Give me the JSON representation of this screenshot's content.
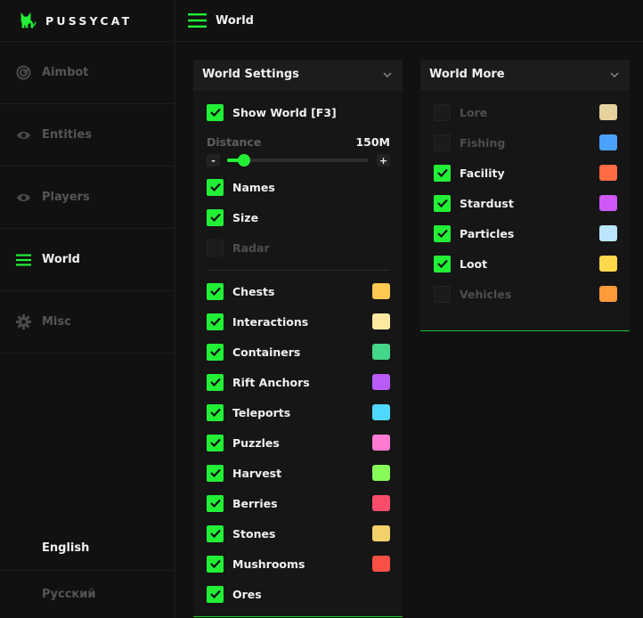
{
  "app": {
    "brand": "PUSSYCAT"
  },
  "header": {
    "title": "World"
  },
  "sidebar": {
    "items": [
      {
        "label": "Aimbot",
        "icon": "crosshair-icon"
      },
      {
        "label": "Entities",
        "icon": "eye-icon"
      },
      {
        "label": "Players",
        "icon": "eye-icon"
      },
      {
        "label": "World",
        "icon": "menu-icon",
        "active": true
      },
      {
        "label": "Misc",
        "icon": "gear-icon"
      }
    ],
    "languages": [
      "English",
      "Русский"
    ],
    "selected_language": "English"
  },
  "world_settings": {
    "title": "World Settings",
    "show_world": {
      "label": "Show World [F3]",
      "checked": true
    },
    "distance": {
      "label": "Distance",
      "value": "150M",
      "fraction": 0.12,
      "minus": "-",
      "plus": "+"
    },
    "options": [
      {
        "label": "Names",
        "checked": true
      },
      {
        "label": "Size",
        "checked": true
      },
      {
        "label": "Radar",
        "checked": false
      }
    ],
    "items": [
      {
        "label": "Chests",
        "checked": true,
        "color": "#ffc850"
      },
      {
        "label": "Interactions",
        "checked": true,
        "color": "#ffe9a0"
      },
      {
        "label": "Containers",
        "checked": true,
        "color": "#44d68a"
      },
      {
        "label": "Rift Anchors",
        "checked": true,
        "color": "#b85cf7"
      },
      {
        "label": "Teleports",
        "checked": true,
        "color": "#4fd8ff"
      },
      {
        "label": "Puzzles",
        "checked": true,
        "color": "#ff7ad2"
      },
      {
        "label": "Harvest",
        "checked": true,
        "color": "#86fb5a"
      },
      {
        "label": "Berries",
        "checked": true,
        "color": "#fc4c6c"
      },
      {
        "label": "Stones",
        "checked": true,
        "color": "#f4d06a"
      },
      {
        "label": "Mushrooms",
        "checked": true,
        "color": "#fc5046"
      },
      {
        "label": "Ores",
        "checked": true,
        "color": null
      }
    ]
  },
  "world_more": {
    "title": "World More",
    "items": [
      {
        "label": "Lore",
        "checked": false,
        "color": "#e6d29e"
      },
      {
        "label": "Fishing",
        "checked": false,
        "color": "#4aa2fb"
      },
      {
        "label": "Facility",
        "checked": true,
        "color": "#fe6b44"
      },
      {
        "label": "Stardust",
        "checked": true,
        "color": "#ce58f8"
      },
      {
        "label": "Particles",
        "checked": true,
        "color": "#b9e6fd"
      },
      {
        "label": "Loot",
        "checked": true,
        "color": "#fed84a"
      },
      {
        "label": "Vehicles",
        "checked": false,
        "color": "#fe9a3a"
      }
    ]
  },
  "colors": {
    "accent": "#22f036",
    "background": "#111111",
    "panel": "#161616"
  }
}
